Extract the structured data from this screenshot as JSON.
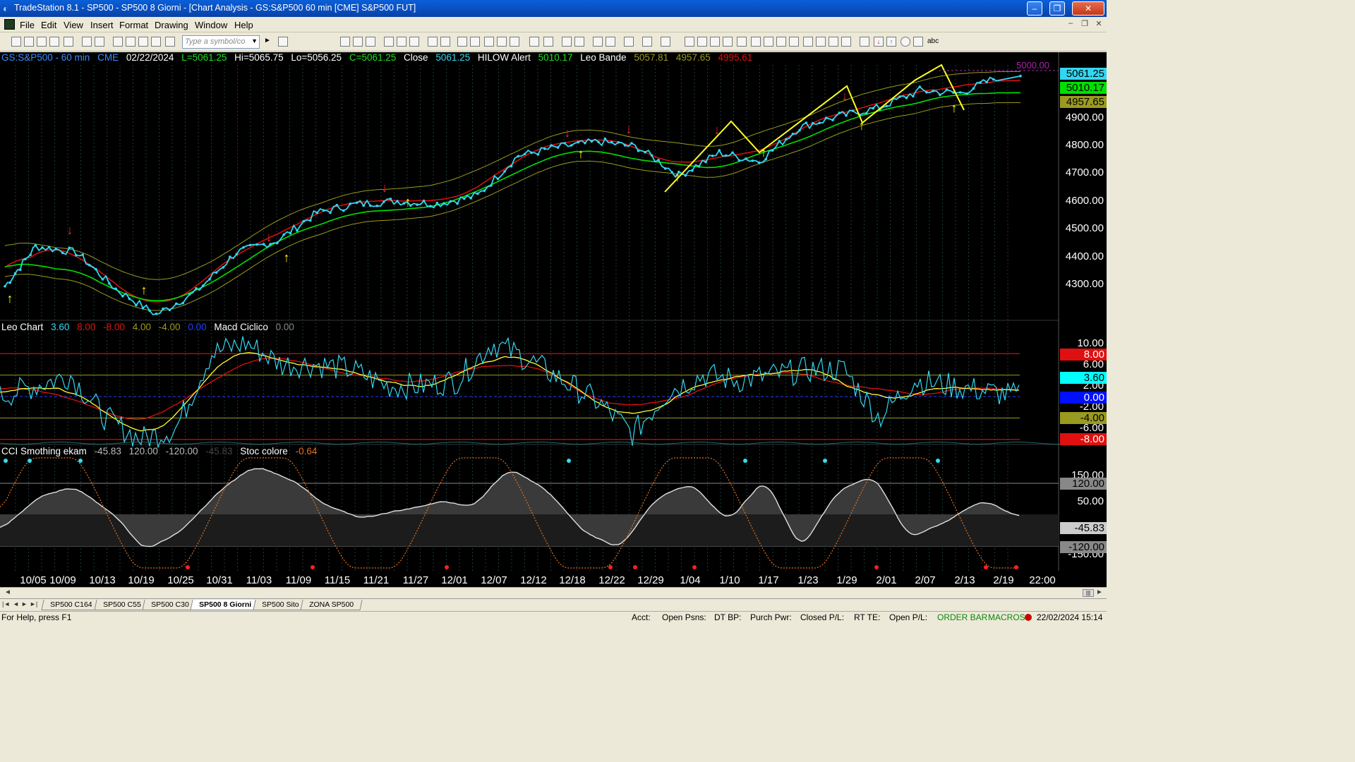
{
  "window": {
    "title": "TradeStation 8.1 - SP500 - SP500 8 Giorni - [Chart Analysis - GS:S&P500 60 min [CME] S&P500 FUT]",
    "minimize": "–",
    "restore": "❐",
    "close": "✕"
  },
  "menu": [
    "File",
    "Edit",
    "View",
    "Insert",
    "Format",
    "Drawing",
    "Window",
    "Help"
  ],
  "toolbar": {
    "symbol_placeholder": "Type a symbol/co",
    "abc_label": "abc"
  },
  "price_header": {
    "symbol": "GS:S&P500 - 60 min",
    "exchange": "CME",
    "date": "02/22/2024",
    "last": "L=5061.25",
    "high": "Hi=5065.75",
    "low": "Lo=5056.25",
    "close_val": "C=5061.25",
    "close_label": "Close",
    "close_num": "5061.25",
    "hilow_label": "HILOW Alert",
    "hilow_val": "5010.17",
    "leo_label": "Leo Bande",
    "leo_v1": "5057.81",
    "leo_v2": "4957.65",
    "leo_v3": "4995.61",
    "corner_label": "5000.00"
  },
  "price_axis": [
    "4900.00",
    "4800.00",
    "4700.00",
    "4600.00",
    "4500.00",
    "4400.00",
    "4300.00"
  ],
  "price_boxes": [
    "5061.25",
    "5010.17",
    "4957.65"
  ],
  "leo_header": {
    "name": "Leo Chart",
    "v1": "3.60",
    "v2": "8.00",
    "v3": "-8.00",
    "v4": "4.00",
    "v5": "-4.00",
    "v6": "0.00",
    "macd_label": "Macd Ciclico",
    "macd_val": "0.00"
  },
  "leo_axis": [
    "10.00",
    "6.00",
    "2.00",
    "-2.00",
    "-6.00"
  ],
  "leo_boxes": [
    "8.00",
    "3.60",
    "0.00",
    "-4.00",
    "-8.00"
  ],
  "cci_header": {
    "name": "CCI Smothing ekam",
    "v1": "-45.83",
    "v2": "120.00",
    "v3": "-120.00",
    "v4": "-45.83",
    "stoc_label": "Stoc colore",
    "stoc_val": "-0.64"
  },
  "cci_axis": [
    "150.00",
    "50.00",
    "-150.00"
  ],
  "cci_boxes": [
    "120.00",
    "-45.83",
    "-120.00"
  ],
  "dates": [
    "10/05",
    "10/09",
    "10/13",
    "10/19",
    "10/25",
    "10/31",
    "11/03",
    "11/09",
    "11/15",
    "11/21",
    "11/27",
    "12/01",
    "12/07",
    "12/12",
    "12/18",
    "12/22",
    "12/29",
    "1/04",
    "1/10",
    "1/17",
    "1/23",
    "1/29",
    "2/01",
    "2/07",
    "2/13",
    "2/19",
    "22:00"
  ],
  "tabs": [
    "SP500 C164",
    "SP500 C55",
    "SP500 C30",
    "SP500 8 Giorni",
    "SP500 Sito",
    "ZONA SP500"
  ],
  "active_tab": "SP500 8 Giorni",
  "status": {
    "help": "For Help, press F1",
    "acct": "Acct:",
    "open_psns": "Open Psns:",
    "dt_bp": "DT BP:",
    "purch_pwr": "Purch Pwr:",
    "closed_pl": "Closed P/L:",
    "rt_te": "RT TE:",
    "open_pl": "Open P/L:",
    "order_bar": "ORDER BAR",
    "macros": "MACROS",
    "datetime": "22/02/2024 15:14"
  },
  "colors": {
    "price": "#33d6f0",
    "green_band": "#00e000",
    "red_band": "#e01010",
    "olive_band": "#9a9a20",
    "yellow": "#ffff20",
    "up_arrow": "#ffff00",
    "down_arrow": "#ff2020",
    "cci_fill": "#3a3a3a"
  },
  "chart_data": [
    {
      "type": "line",
      "title": "GS:S&P500 - 60 min",
      "x": [
        "10/05",
        "10/09",
        "10/13",
        "10/19",
        "10/25",
        "10/31",
        "11/03",
        "11/09",
        "11/15",
        "11/21",
        "11/27",
        "12/01",
        "12/07",
        "12/12",
        "12/18",
        "12/22",
        "12/29",
        "1/04",
        "1/10",
        "1/17",
        "1/23",
        "1/29",
        "2/01",
        "2/07",
        "2/13",
        "2/19"
      ],
      "series": [
        {
          "values": [
            4320,
            4460,
            4440,
            4310,
            4220,
            4300,
            4440,
            4480,
            4580,
            4610,
            4620,
            4610,
            4640,
            4780,
            4810,
            4830,
            4810,
            4710,
            4790,
            4760,
            4880,
            4920,
            4950,
            5010,
            5000,
            5061
          ]
        }
      ],
      "ylim": [
        4200,
        5100
      ]
    }
  ]
}
